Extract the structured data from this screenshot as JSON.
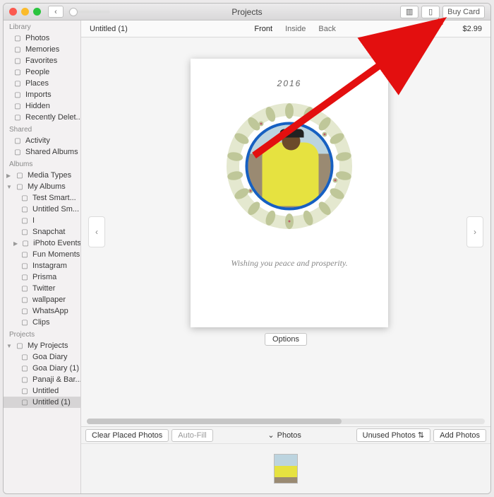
{
  "titlebar": {
    "title": "Projects",
    "buy_label": "Buy Card"
  },
  "subbar": {
    "project_name": "Untitled (1)",
    "views": {
      "front": "Front",
      "inside": "Inside",
      "back": "Back",
      "active": "front"
    },
    "price": "$2.99"
  },
  "sidebar": {
    "sections": [
      {
        "header": "Library",
        "items": [
          {
            "label": "Photos",
            "icon": "photos-icon"
          },
          {
            "label": "Memories",
            "icon": "memories-icon"
          },
          {
            "label": "Favorites",
            "icon": "heart-icon"
          },
          {
            "label": "People",
            "icon": "people-icon"
          },
          {
            "label": "Places",
            "icon": "pin-icon"
          },
          {
            "label": "Imports",
            "icon": "import-icon"
          },
          {
            "label": "Hidden",
            "icon": "hidden-icon"
          },
          {
            "label": "Recently Delet...",
            "icon": "trash-icon"
          }
        ]
      },
      {
        "header": "Shared",
        "items": [
          {
            "label": "Activity",
            "icon": "cloud-icon"
          },
          {
            "label": "Shared Albums",
            "icon": "shared-album-icon"
          }
        ]
      },
      {
        "header": "Albums",
        "items": [
          {
            "label": "Media Types",
            "icon": "media-icon",
            "disclosure": "closed"
          },
          {
            "label": "My Albums",
            "icon": "album-icon",
            "disclosure": "open"
          },
          {
            "label": "Test Smart...",
            "icon": "smart-album-icon",
            "indent": 1
          },
          {
            "label": "Untitled Sm...",
            "icon": "smart-album-icon",
            "indent": 1
          },
          {
            "label": "I",
            "icon": "album-icon",
            "indent": 1
          },
          {
            "label": "Snapchat",
            "icon": "album-thumb-icon",
            "indent": 1
          },
          {
            "label": "iPhoto Events",
            "icon": "folder-icon",
            "indent": 1,
            "disclosure": "closed"
          },
          {
            "label": "Fun Moments",
            "icon": "album-thumb-icon",
            "indent": 1
          },
          {
            "label": "Instagram",
            "icon": "album-icon",
            "indent": 1
          },
          {
            "label": "Prisma",
            "icon": "album-icon",
            "indent": 1
          },
          {
            "label": "Twitter",
            "icon": "album-icon",
            "indent": 1
          },
          {
            "label": "wallpaper",
            "icon": "album-icon",
            "indent": 1
          },
          {
            "label": "WhatsApp",
            "icon": "album-icon",
            "indent": 1
          },
          {
            "label": "Clips",
            "icon": "album-icon",
            "indent": 1
          }
        ]
      },
      {
        "header": "Projects",
        "items": [
          {
            "label": "My Projects",
            "icon": "folder-icon",
            "disclosure": "open"
          },
          {
            "label": "Goa Diary",
            "icon": "book-icon",
            "indent": 1
          },
          {
            "label": "Goa Diary (1)",
            "icon": "book-icon",
            "indent": 1
          },
          {
            "label": "Panaji & Bar...",
            "icon": "book-icon",
            "indent": 1
          },
          {
            "label": "Untitled",
            "icon": "book-icon",
            "indent": 1
          },
          {
            "label": "Untitled (1)",
            "icon": "book-icon",
            "indent": 1,
            "selected": true
          }
        ]
      }
    ]
  },
  "card": {
    "year": "2016",
    "message": "Wishing you peace and prosperity.",
    "options_label": "Options"
  },
  "tray": {
    "clear_label": "Clear Placed Photos",
    "autofill_label": "Auto-Fill",
    "section_label": "Photos",
    "unused_label": "Unused Photos",
    "add_label": "Add Photos"
  },
  "colors": {
    "accent": "#1660c2",
    "arrow": "#e30f0f"
  }
}
